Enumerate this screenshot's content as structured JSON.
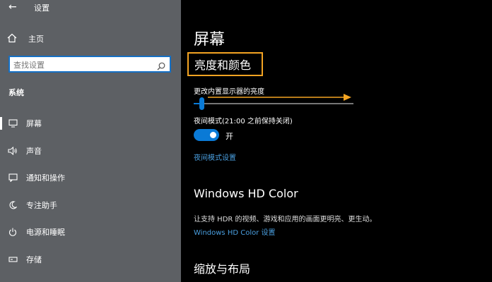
{
  "window": {
    "title": "设置",
    "back_glyph": "←"
  },
  "sidebar": {
    "home_label": "主页",
    "search": {
      "placeholder": "查找设置"
    },
    "section_label": "系统",
    "items": [
      {
        "label": "屏幕",
        "icon": "monitor-icon",
        "active": true
      },
      {
        "label": "声音",
        "icon": "speaker-icon"
      },
      {
        "label": "通知和操作",
        "icon": "notification-icon"
      },
      {
        "label": "专注助手",
        "icon": "moon-icon"
      },
      {
        "label": "电源和睡眠",
        "icon": "power-icon"
      },
      {
        "label": "存储",
        "icon": "storage-icon"
      }
    ]
  },
  "main": {
    "title": "屏幕",
    "brightness": {
      "group_title": "亮度和颜色",
      "slider_label": "更改内置显示器的亮度",
      "slider_value": 0.05,
      "night_mode_label": "夜间模式(21:00 之前保持关闭)",
      "toggle_state": "开",
      "night_settings_link": "夜间模式设置"
    },
    "hd": {
      "title": "Windows HD Color",
      "description": "让支持 HDR 的视频、游戏和应用的画面更明亮、更生动。",
      "link": "Windows HD Color 设置"
    },
    "scale": {
      "title": "缩放与布局"
    }
  },
  "colors": {
    "accent": "#0a7ad6",
    "highlight_border": "#f4a422",
    "arrow": "#f4a422",
    "sidebar_bg": "#5d6064"
  }
}
